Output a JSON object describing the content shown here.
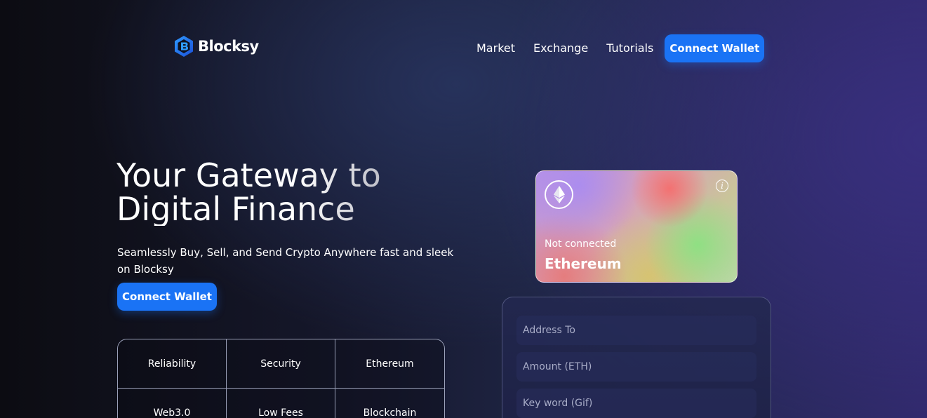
{
  "brand": {
    "name": "Blocksy"
  },
  "nav": {
    "links": [
      "Market",
      "Exchange",
      "Tutorials"
    ],
    "cta_label": "Connect Wallet"
  },
  "hero": {
    "title": "Your Gateway to Digital Finance",
    "subtitle": "Seamlessly Buy, Sell, and Send Crypto Anywhere fast and sleek on Blocksy",
    "cta_label": "Connect Wallet"
  },
  "features": [
    "Reliability",
    "Security",
    "Ethereum",
    "Web3.0",
    "Low Fees",
    "Blockchain"
  ],
  "card": {
    "icon": "ethereum-icon",
    "status": "Not connected",
    "network": "Ethereum"
  },
  "form": {
    "address_placeholder": "Address To",
    "amount_placeholder": "Amount (ETH)",
    "keyword_placeholder": "Key word (Gif)"
  },
  "colors": {
    "accent": "#1a73f5",
    "background_dark": "#0c0c12",
    "background_purple": "#30296a"
  }
}
